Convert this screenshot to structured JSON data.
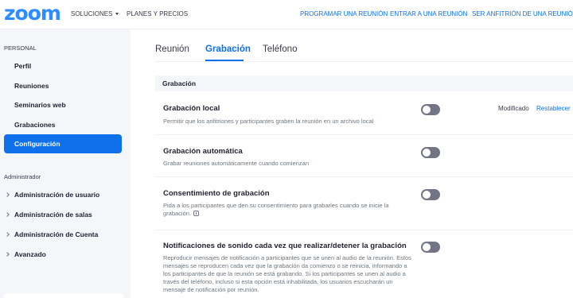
{
  "app": {
    "logo": "zoom"
  },
  "topnav": {
    "solutions": "SOLUCIONES",
    "plans": "PLANES Y PRECIOS",
    "schedule": "PROGRAMAR UNA REUNIÓN",
    "join": "ENTRAR A UNA REUNIÓN",
    "host": "SER ANFITRIÓN DE UNA REUNIÓN"
  },
  "sidebar": {
    "personal_label": "PERSONAL",
    "items": [
      "Perfil",
      "Reuniones",
      "Seminarios web",
      "Grabaciones"
    ],
    "active": "Configuración",
    "admin_label": "Administrador",
    "admin_items": [
      "Administración de usuario",
      "Administración de salas",
      "Administración de Cuenta",
      "Avanzado"
    ]
  },
  "tabs": [
    "Reunión",
    "Grabación",
    "Teléfono"
  ],
  "section": {
    "title": "Grabación"
  },
  "settings": [
    {
      "title": "Grabación local",
      "description": "Permitir que los anfitriones y participantes graben la reunión en un archivo local",
      "enabled": false,
      "modified": "Modificado",
      "reset": "Restablecer"
    },
    {
      "title": "Grabación automática",
      "description": "Grabar reuniones automáticamente cuando comienzan",
      "enabled": false
    },
    {
      "title": "Consentimiento de grabación",
      "description": "Pida a los participantes que den su consentimiento para grabarles cuando se inicie la grabación.",
      "enabled": false
    },
    {
      "title": "Notificaciones de sonido cada vez que realizar/detener la grabación",
      "description": "Reproducir mensajes de notificación a participantes que se unen al audio de la reunión. Estos mensajes se reproducen cada vez que la grabación da comienzo o se reinicia, informando a los participantes de que la reunión se está grabando. Si los participantes se unen al audio a través del teléfono, incluso si esta opción está inhabilitada, los usuarios escucharán un mensaje de notificación por reunión.",
      "enabled": false
    }
  ],
  "colors": {
    "brand": "#2d8cff",
    "accent": "#0e71eb",
    "toggle_off": "#747487",
    "sidebar_bg": "#f5f6fa"
  }
}
